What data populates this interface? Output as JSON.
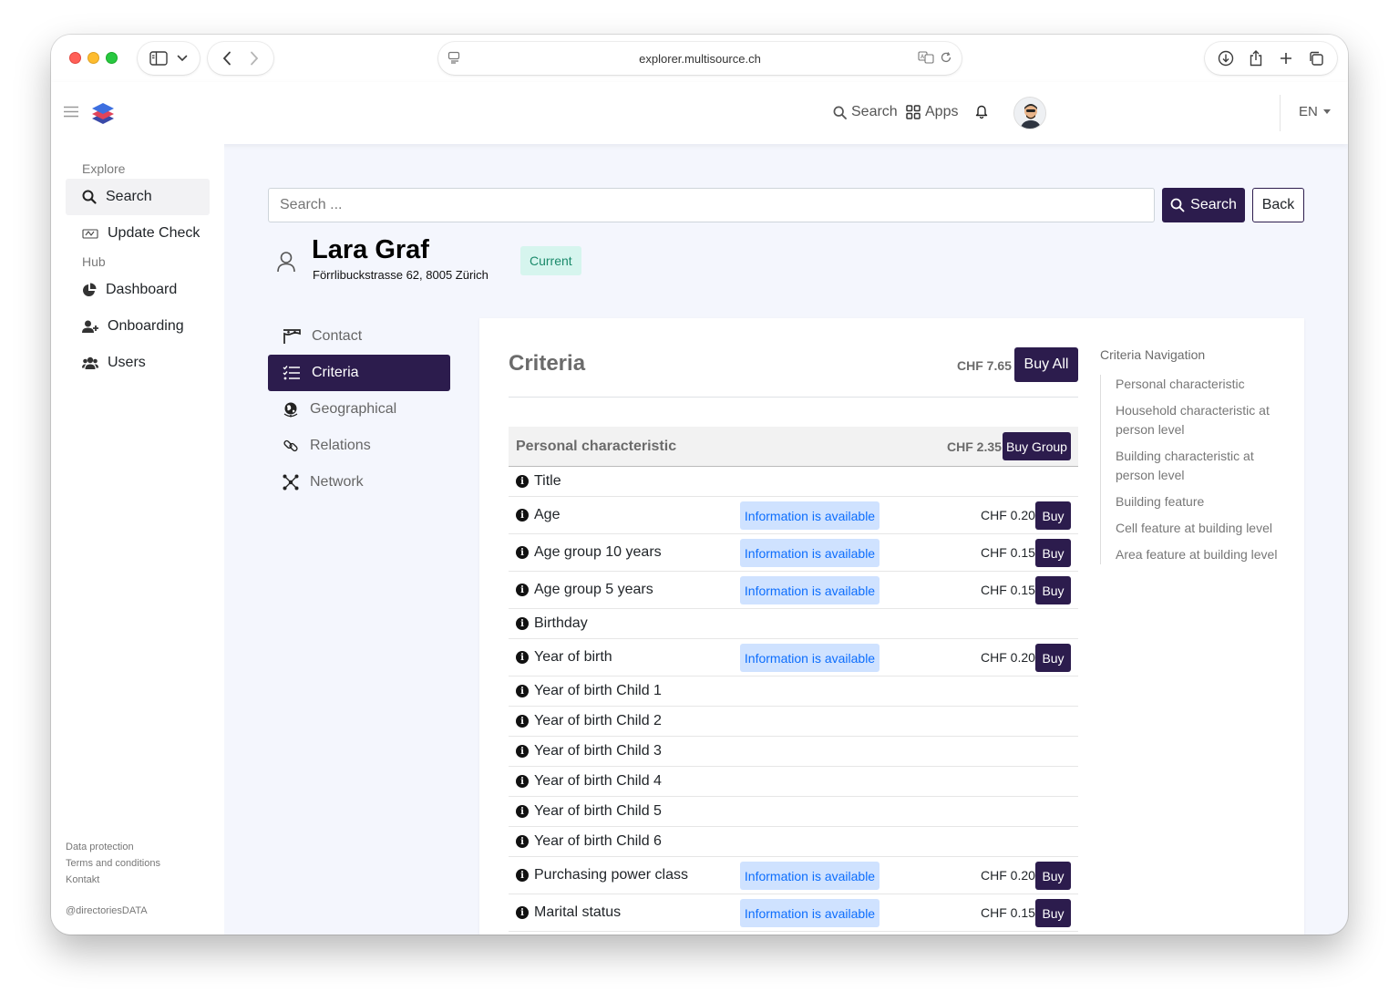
{
  "browser": {
    "url": "explorer.multisource.ch"
  },
  "header": {
    "search_label": "Search",
    "apps_label": "Apps",
    "language": "EN"
  },
  "sidebar": {
    "explore_heading": "Explore",
    "hub_heading": "Hub",
    "items": [
      {
        "label": "Search",
        "icon": "search-icon"
      },
      {
        "label": "Update Check",
        "icon": "update-check-icon"
      },
      {
        "label": "Dashboard",
        "icon": "pie-chart-icon"
      },
      {
        "label": "Onboarding",
        "icon": "user-plus-icon"
      },
      {
        "label": "Users",
        "icon": "users-icon"
      }
    ],
    "footer": {
      "data_protection": "Data protection",
      "terms": "Terms and conditions",
      "contact": "Kontakt",
      "handle": "@directoriesDATA"
    }
  },
  "search": {
    "placeholder": "Search ...",
    "button_label": "Search",
    "back_label": "Back"
  },
  "person": {
    "name": "Lara Graf",
    "address": "Förrlibuckstrasse 62, 8005 Zürich",
    "status": "Current"
  },
  "subnav": [
    {
      "label": "Contact",
      "icon": "contact-icon"
    },
    {
      "label": "Criteria",
      "icon": "checklist-icon",
      "active": true
    },
    {
      "label": "Geographical",
      "icon": "globe-icon"
    },
    {
      "label": "Relations",
      "icon": "link-icon"
    },
    {
      "label": "Network",
      "icon": "network-icon"
    }
  ],
  "criteria": {
    "title": "Criteria",
    "total_price": "CHF 7.65",
    "buy_all_label": "Buy All",
    "group": {
      "title": "Personal characteristic",
      "price": "CHF 2.35",
      "buy_label": "Buy Group"
    },
    "buy_label": "Buy",
    "rows": [
      {
        "name": "Title",
        "status": "",
        "price": ""
      },
      {
        "name": "Age",
        "status": "Information is available",
        "price": "CHF 0.20"
      },
      {
        "name": "Age group 10 years",
        "status": "Information is available",
        "price": "CHF 0.15"
      },
      {
        "name": "Age group 5 years",
        "status": "Information is available",
        "price": "CHF 0.15"
      },
      {
        "name": "Birthday",
        "status": "",
        "price": ""
      },
      {
        "name": "Year of birth",
        "status": "Information is available",
        "price": "CHF 0.20"
      },
      {
        "name": "Year of birth Child 1",
        "status": "",
        "price": ""
      },
      {
        "name": "Year of birth Child 2",
        "status": "",
        "price": ""
      },
      {
        "name": "Year of birth Child 3",
        "status": "",
        "price": ""
      },
      {
        "name": "Year of birth Child 4",
        "status": "",
        "price": ""
      },
      {
        "name": "Year of birth Child 5",
        "status": "",
        "price": ""
      },
      {
        "name": "Year of birth Child 6",
        "status": "",
        "price": ""
      },
      {
        "name": "Purchasing power class",
        "status": "Information is available",
        "price": "CHF 0.20"
      },
      {
        "name": "Marital status",
        "status": "Information is available",
        "price": "CHF 0.15"
      }
    ]
  },
  "criteria_navigation": {
    "heading": "Criteria Navigation",
    "items": [
      "Personal characteristic",
      "Household characteristic at person level",
      "Building characteristic at person level",
      "Building feature",
      "Cell feature at building level",
      "Area feature at building level"
    ]
  },
  "colors": {
    "primary": "#2c1c4d",
    "info_badge_bg": "#cfe2ff",
    "info_badge_text": "#0d6efd",
    "current_badge_bg": "#d6f5ee",
    "current_badge_text": "#1b8a6b"
  }
}
